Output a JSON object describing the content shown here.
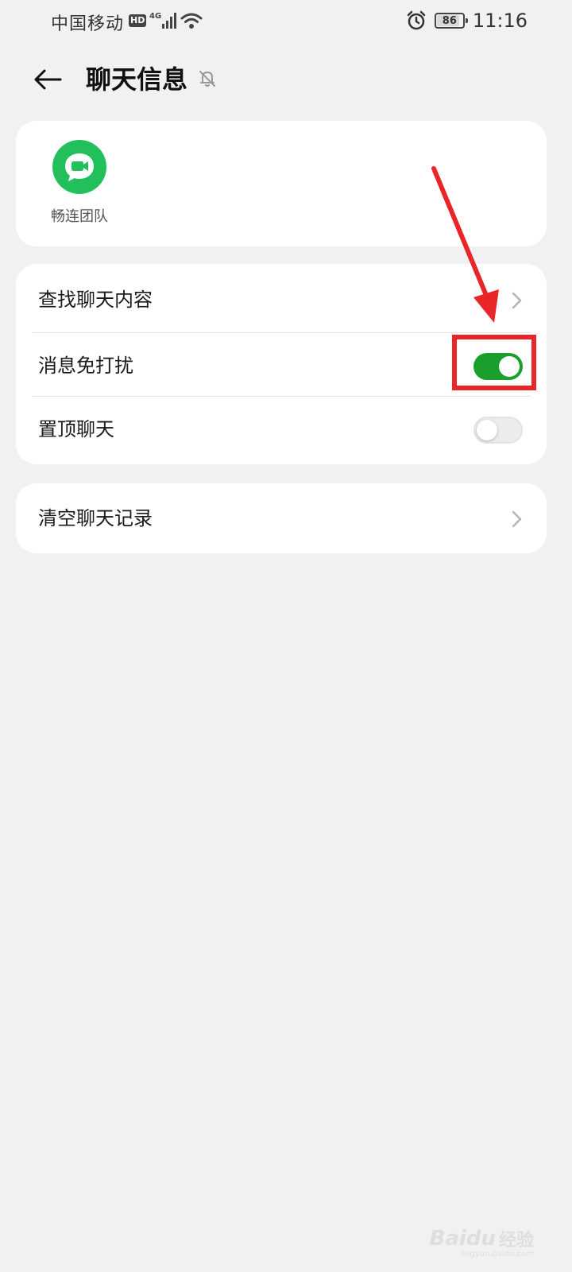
{
  "status_bar": {
    "carrier": "中国移动",
    "hd_badge": "HD",
    "network": "4G",
    "battery_level": "86",
    "battery_percent": 86,
    "time": "11:16",
    "icons": [
      "hd-icon",
      "signal-icon",
      "wifi-icon",
      "alarm-icon",
      "battery-icon"
    ]
  },
  "header": {
    "title": "聊天信息",
    "back_icon": "back-arrow-icon",
    "status_icon": "muted-bell-icon"
  },
  "members": [
    {
      "name": "畅连团队",
      "avatar_icon": "video-chat-icon",
      "avatar_color": "#21c05a"
    }
  ],
  "settings": {
    "find_content": {
      "label": "查找聊天内容"
    },
    "do_not_disturb": {
      "label": "消息免打扰",
      "enabled": true
    },
    "pin_chat": {
      "label": "置顶聊天",
      "enabled": false
    }
  },
  "clear_history": {
    "label": "清空聊天记录"
  },
  "colors": {
    "background": "#f1f1f3",
    "card": "#ffffff",
    "toggle_on": "#1a9e2c",
    "annotation_red": "#e8262a"
  },
  "watermark": {
    "logo": "Baidu",
    "text": "经验",
    "sub": "jingyan.baidu.com"
  }
}
